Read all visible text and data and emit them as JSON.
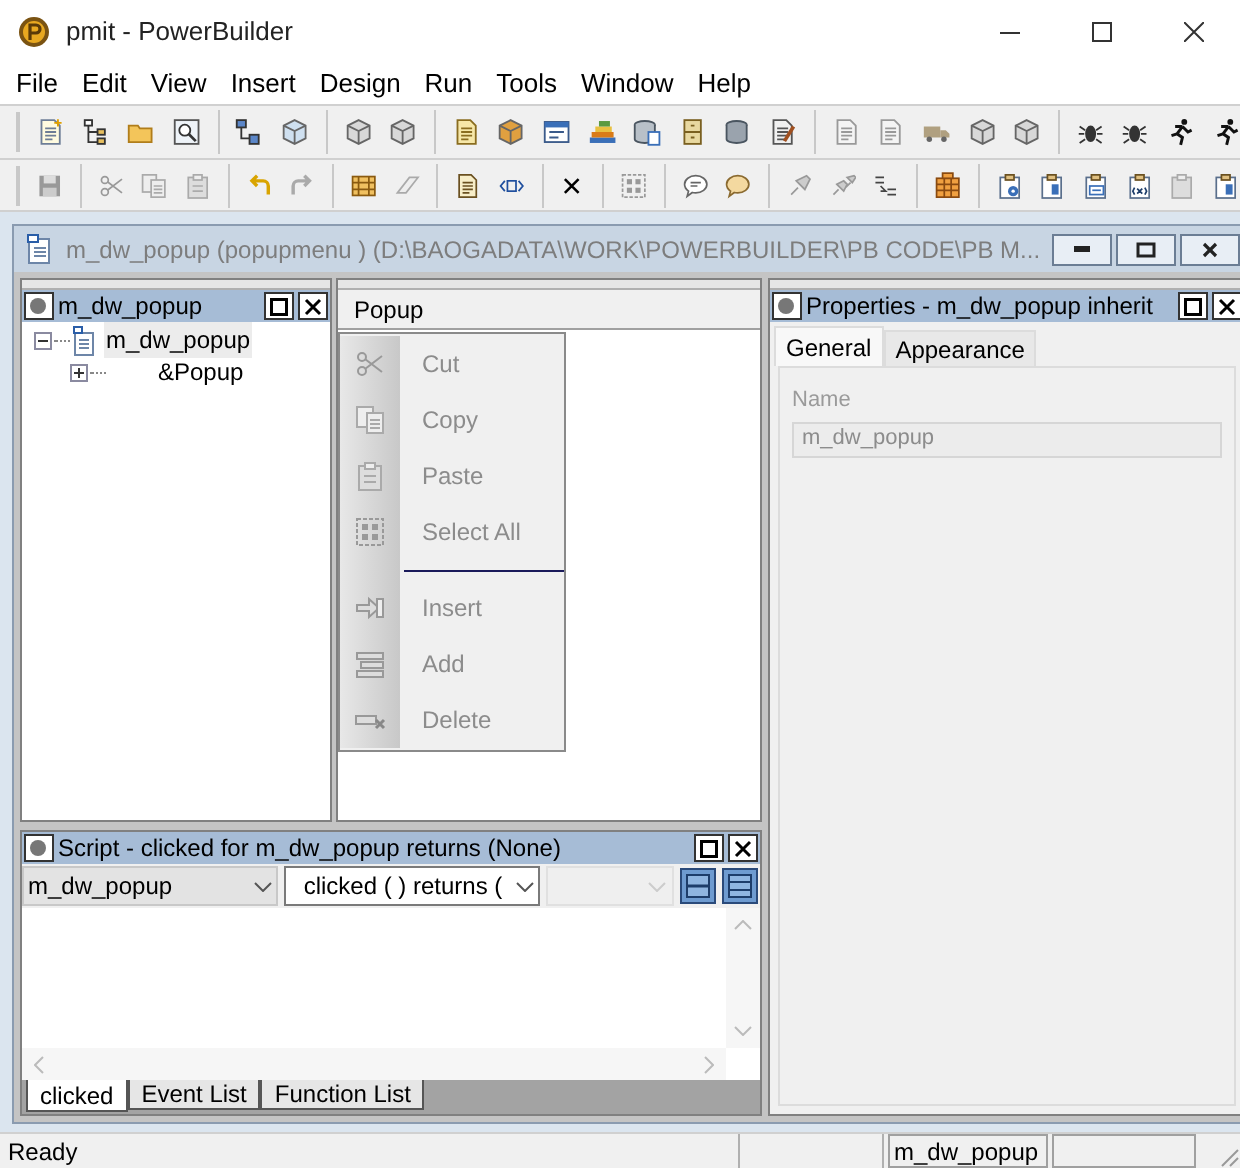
{
  "window": {
    "title": "pmit - PowerBuilder"
  },
  "menu_bar": [
    "File",
    "Edit",
    "View",
    "Insert",
    "Design",
    "Run",
    "Tools",
    "Window",
    "Help"
  ],
  "sheet": {
    "title": "m_dw_popup (popupmenu ) (D:\\BAOGADATA\\WORK\\POWERBUILDER\\PB CODE\\PB M..."
  },
  "tree_panel": {
    "title": "m_dw_popup",
    "tree": [
      {
        "label": "m_dw_popup",
        "selected": true,
        "expanded": true,
        "children": [
          {
            "label": "&Popup",
            "selected": false,
            "expanded": false
          }
        ]
      }
    ]
  },
  "menu_preview": {
    "menu_title": "Popup",
    "items": [
      {
        "kind": "item",
        "label": "Cut",
        "disabled": true
      },
      {
        "kind": "item",
        "label": "Copy",
        "disabled": true
      },
      {
        "kind": "item",
        "label": "Paste",
        "disabled": true
      },
      {
        "kind": "item",
        "label": "Select All",
        "disabled": true
      },
      {
        "kind": "separator"
      },
      {
        "kind": "item",
        "label": "Insert",
        "disabled": true
      },
      {
        "kind": "item",
        "label": "Add",
        "disabled": true
      },
      {
        "kind": "item",
        "label": "Delete",
        "disabled": true
      }
    ]
  },
  "properties_panel": {
    "title": "Properties - m_dw_popup  inherit",
    "tabs": [
      {
        "label": "General",
        "selected": true
      },
      {
        "label": "Appearance",
        "selected": false
      }
    ],
    "name_label": "Name",
    "name_value": "m_dw_popup",
    "name_disabled": true
  },
  "script_panel": {
    "title": "Script - clicked for m_dw_popup returns (None)",
    "object_dropdown": "m_dw_popup",
    "event_dropdown": "clicked ( ) returns (",
    "ancestor_dropdown_disabled": true,
    "tabs": [
      {
        "label": "clicked",
        "selected": true
      },
      {
        "label": "Event List",
        "selected": false
      },
      {
        "label": "Function List",
        "selected": false
      }
    ]
  },
  "status_bar": {
    "message": "Ready",
    "object": "m_dw_popup"
  }
}
